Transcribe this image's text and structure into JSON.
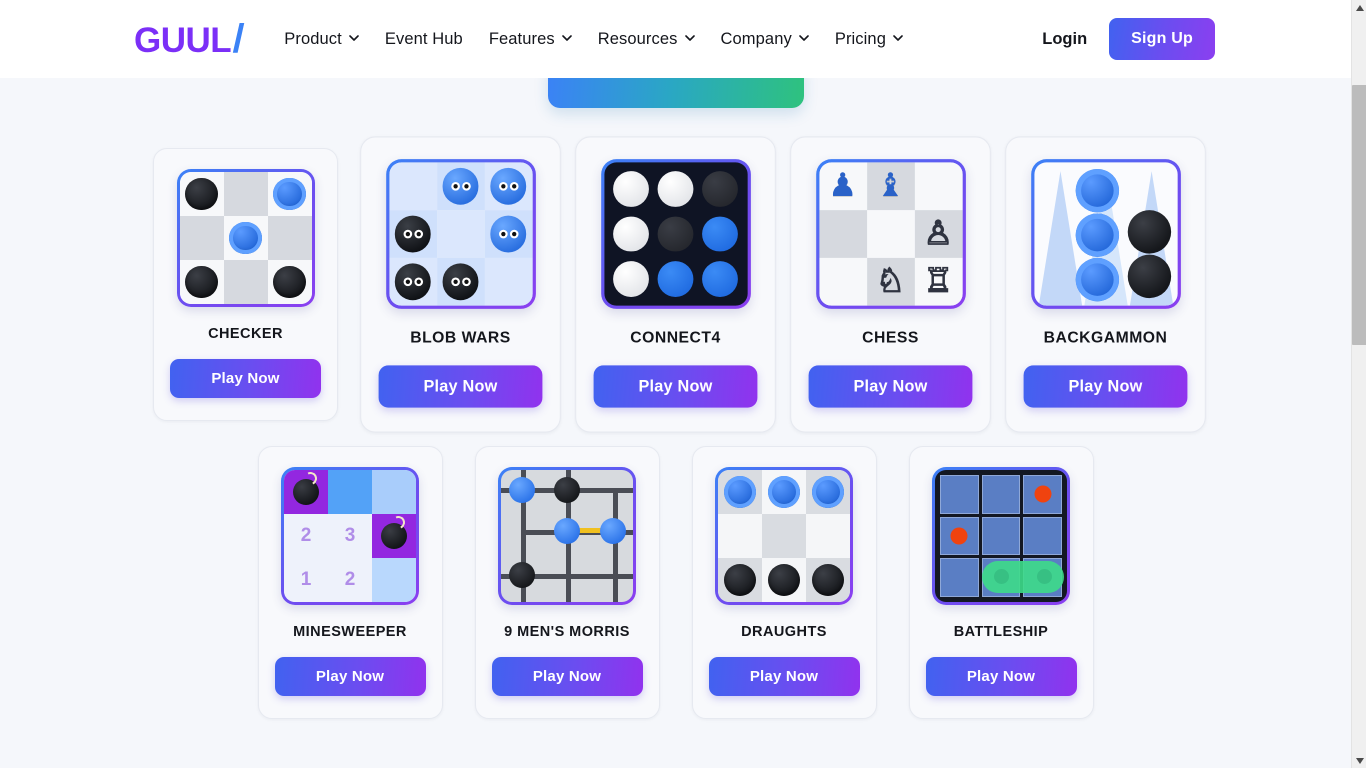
{
  "header": {
    "logo_text": "GUUL",
    "logo_slash": "/",
    "nav": [
      {
        "label": "Product",
        "has_dropdown": true,
        "icon": "chevron-down-icon"
      },
      {
        "label": "Event Hub",
        "has_dropdown": false
      },
      {
        "label": "Features",
        "has_dropdown": true,
        "icon": "chevron-down-icon"
      },
      {
        "label": "Resources",
        "has_dropdown": true,
        "icon": "chevron-down-icon"
      },
      {
        "label": "Company",
        "has_dropdown": true,
        "icon": "chevron-down-icon"
      },
      {
        "label": "Pricing",
        "has_dropdown": true,
        "icon": "chevron-down-icon"
      }
    ],
    "login_label": "Login",
    "signup_label": "Sign Up"
  },
  "colors": {
    "brand_purple": "#7b2ff7",
    "brand_blue": "#3b82f6",
    "button_gradient_start": "#4162f0",
    "button_gradient_end": "#9132ee",
    "page_background": "#f5f7fb",
    "card_background": "#f8f9fc",
    "hero_gradient_start": "#3b82f6",
    "hero_gradient_end": "#2ec27e",
    "piece_blue": "#2a6fe0",
    "piece_black": "#17191d",
    "mine_purple": "#9327e0",
    "battleship_hit": "#f0430f",
    "battleship_ship": "#3ddc8a",
    "morris_line_gold": "#f0c020"
  },
  "games": {
    "play_label": "Play Now",
    "row1": [
      {
        "title": "CHECKER",
        "board": "checker",
        "play_label": "Play Now"
      },
      {
        "title": "BLOB WARS",
        "board": "blob-wars",
        "play_label": "Play Now",
        "featured": true
      },
      {
        "title": "CONNECT4",
        "board": "connect4",
        "play_label": "Play Now",
        "featured": true
      },
      {
        "title": "CHESS",
        "board": "chess",
        "play_label": "Play Now",
        "featured": true
      },
      {
        "title": "BACKGAMMON",
        "board": "backgammon",
        "play_label": "Play Now",
        "featured": true
      }
    ],
    "row2": [
      {
        "title": "MINESWEEPER",
        "board": "minesweeper",
        "play_label": "Play Now"
      },
      {
        "title": "9 MEN'S MORRIS",
        "board": "nine-mens-morris",
        "play_label": "Play Now"
      },
      {
        "title": "DRAUGHTS",
        "board": "draughts",
        "play_label": "Play Now"
      },
      {
        "title": "BATTLESHIP",
        "board": "battleship",
        "play_label": "Play Now"
      }
    ]
  },
  "boards": {
    "minesweeper_numbers": {
      "r1c1": "2",
      "r1c2": "3",
      "r2c1": "1",
      "r2c2": "2"
    },
    "chess_pieces": {
      "blue_pawn": "♟",
      "blue_bishop": "♝",
      "white_pawn": "♙",
      "white_knight": "♘",
      "white_rook": "♖"
    }
  },
  "scrollbar": {
    "up_arrow": "▲",
    "down_arrow": "▼"
  }
}
